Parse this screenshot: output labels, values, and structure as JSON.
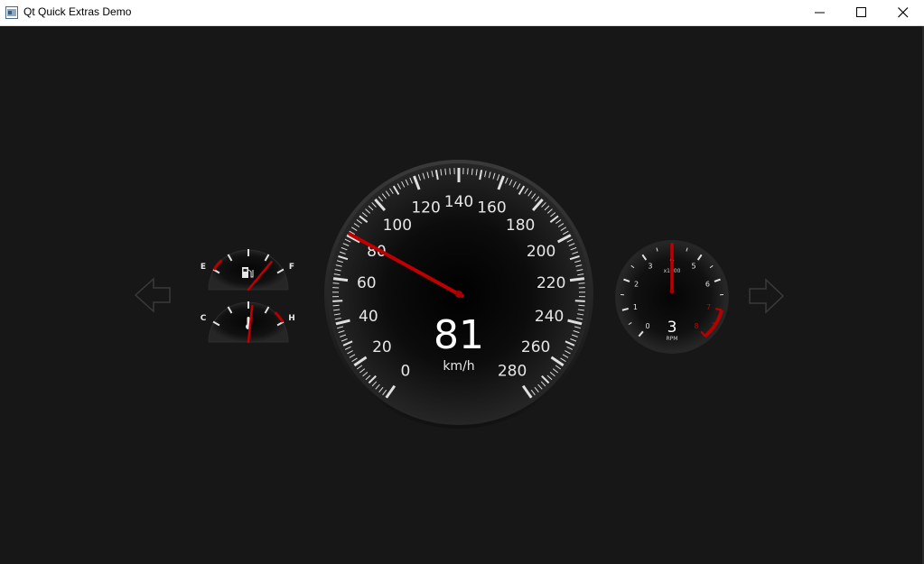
{
  "window": {
    "title": "Qt Quick Extras Demo",
    "icon": "window-app-icon",
    "controls": [
      "minimize-icon",
      "maximize-icon",
      "close-icon"
    ]
  },
  "nav": {
    "left_icon": "arrow-left-icon",
    "right_icon": "arrow-right-icon"
  },
  "speedometer": {
    "value": 81,
    "unit": "km/h",
    "min": 0,
    "max": 280,
    "labels": [
      "0",
      "20",
      "40",
      "60",
      "80",
      "100",
      "120",
      "140",
      "160",
      "180",
      "200",
      "220",
      "240",
      "260",
      "280"
    ]
  },
  "fuel_gauge": {
    "label_empty": "E",
    "label_full": "F",
    "icon": "fuel-pump-icon",
    "level": 0.83
  },
  "temp_gauge": {
    "label_cold": "C",
    "label_hot": "H",
    "icon": "thermometer-icon",
    "level": 0.55
  },
  "tachometer": {
    "value": 3,
    "multiplier": "x1000",
    "unit": "RPM",
    "labels": [
      "0",
      "1",
      "2",
      "3",
      "4",
      "5",
      "6",
      "7",
      "8"
    ],
    "needle_value": 4,
    "redline_start": 7
  },
  "colors": {
    "background": "#171717",
    "needle": "#c00000",
    "redline": "#b30000",
    "text": "#e6e6e6"
  }
}
